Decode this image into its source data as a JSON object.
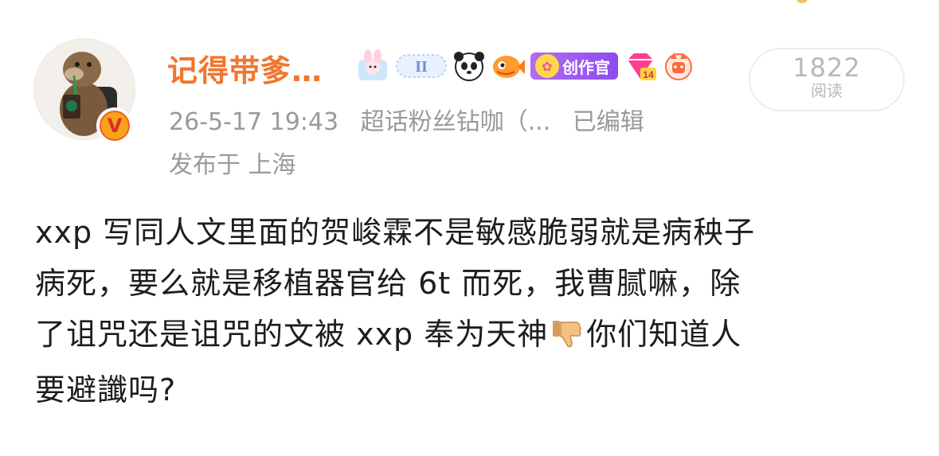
{
  "author": {
    "name": "记得带爹…",
    "verified_badge": "V"
  },
  "badges": [
    {
      "name": "bunny-badge-icon"
    },
    {
      "name": "gemini-badge-icon",
      "text": "II"
    },
    {
      "name": "panda-badge-icon"
    },
    {
      "name": "fish-badge-icon"
    },
    {
      "name": "creator-badge",
      "text": "创作官"
    },
    {
      "name": "diamond-level-badge-icon",
      "text": "14"
    },
    {
      "name": "fox-badge-icon"
    }
  ],
  "meta": {
    "time": "26-5-17 19:43",
    "source": "超话粉丝钻咖（...",
    "edited": "已编辑",
    "location": "发布于 上海"
  },
  "views": {
    "count": "1822",
    "label": "阅读"
  },
  "post": {
    "line1": "xxp 写同人文里面的贺峻霖不是敏感脆弱就是病秧子",
    "line2": "病死，要么就是移植器官给 6t 而死，我曹腻嘛，除",
    "line3a": "了诅咒还是诅咒的文被 xxp 奉为天神",
    "line3b": "你们知道人",
    "line4": "要避讖吗?"
  },
  "colors": {
    "username": "#f1762e",
    "meta": "#9a9a9a",
    "body_text": "#1d1d1d",
    "creator_badge": "#9b59f0"
  }
}
